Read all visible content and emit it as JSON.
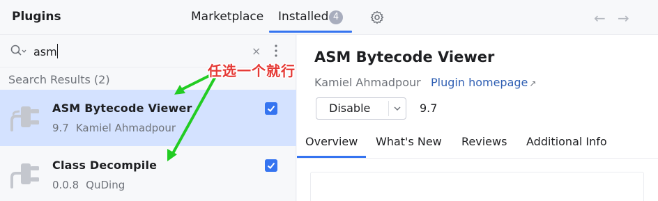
{
  "header": {
    "title": "Plugins",
    "tabs": {
      "marketplace": "Marketplace",
      "installed": "Installed",
      "installed_count": "4"
    },
    "back_glyph": "←",
    "forward_glyph": "→"
  },
  "search": {
    "value": "asm",
    "clear_glyph": "×",
    "results_label": "Search Results (2)"
  },
  "plugins": [
    {
      "name": "ASM Bytecode Viewer",
      "version": "9.7",
      "author": "Kamiel Ahmadpour",
      "enabled": true,
      "selected": true
    },
    {
      "name": "Class Decompile",
      "version": "0.0.8",
      "author": "QuDing",
      "enabled": true,
      "selected": false
    }
  ],
  "detail": {
    "title": "ASM Bytecode Viewer",
    "author": "Kamiel Ahmadpour",
    "homepage_label": "Plugin homepage",
    "homepage_glyph": "↗",
    "disable_label": "Disable",
    "version": "9.7",
    "tabs": [
      "Overview",
      "What's New",
      "Reviews",
      "Additional Info"
    ]
  },
  "annotation": {
    "text": "任选一个就行",
    "color": "#e53935",
    "arrow_color": "#22cc22"
  },
  "colors": {
    "accent": "#3574f0",
    "selection": "#d4e2ff",
    "link": "#2f5fb3"
  }
}
